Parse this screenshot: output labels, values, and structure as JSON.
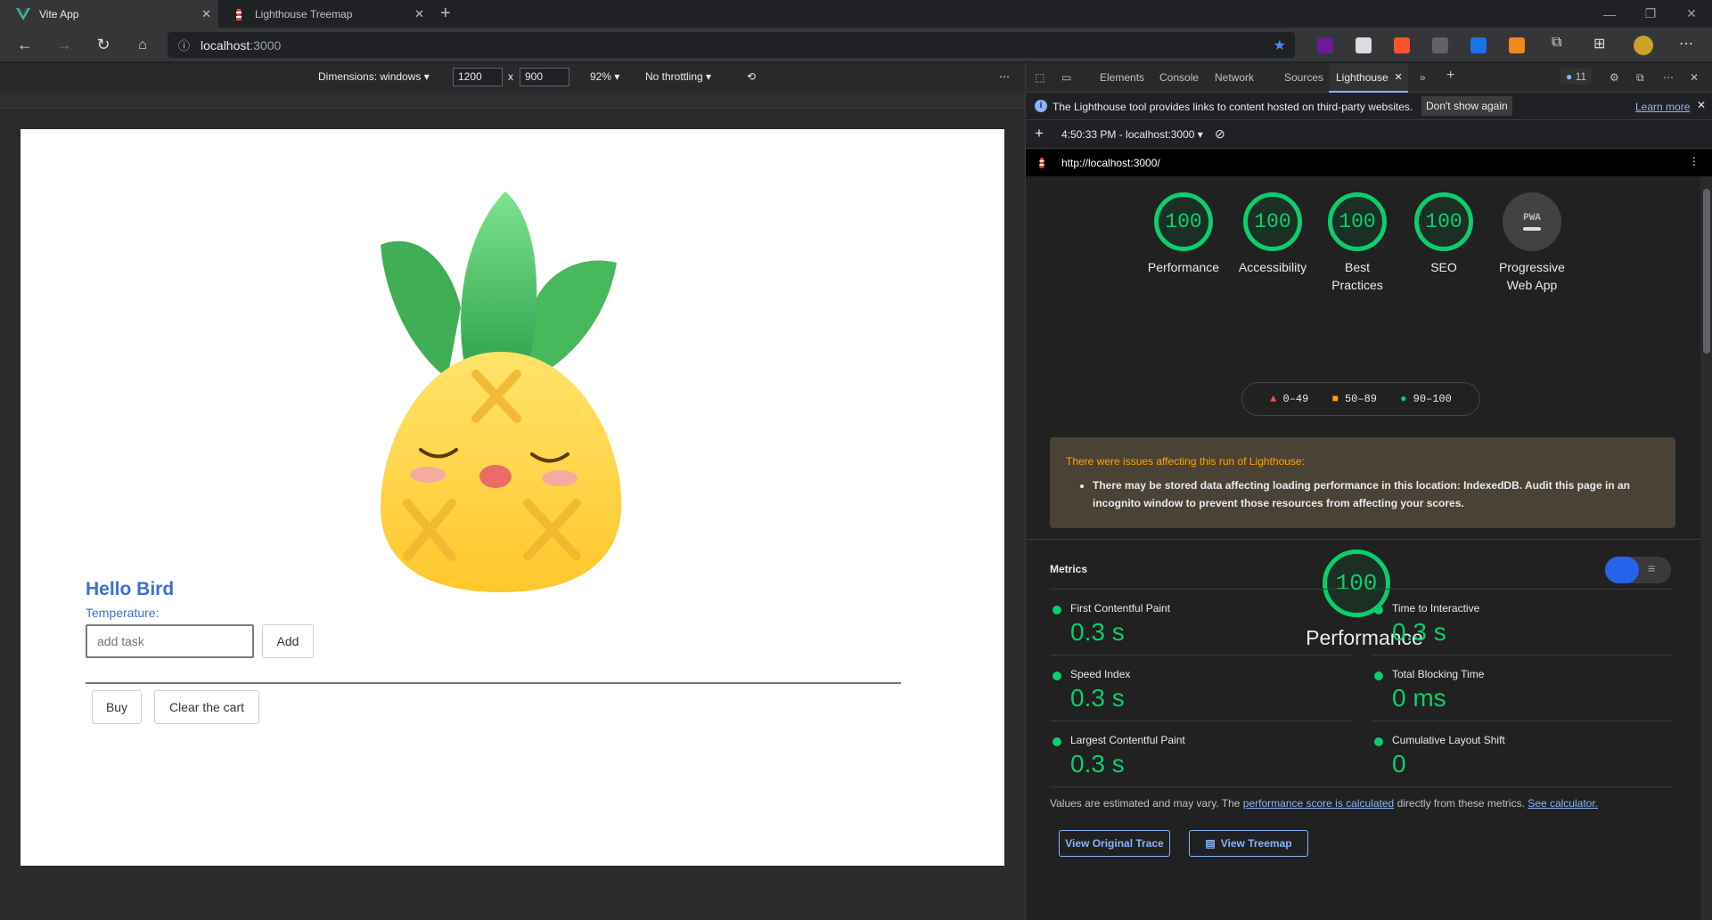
{
  "browser": {
    "tabs": [
      {
        "title": "Vite App"
      },
      {
        "title": "Lighthouse Treemap"
      }
    ],
    "address": {
      "host": "localhost",
      "port": ":3000"
    }
  },
  "device_toolbar": {
    "dimensions_label": "Dimensions: windows",
    "width": "1200",
    "height": "900",
    "times": "x",
    "zoom": "92%",
    "throttling": "No throttling"
  },
  "page": {
    "heading": "Hello Bird",
    "temperature_label": "Temperature:",
    "task_placeholder": "add task",
    "add_label": "Add",
    "buy_label": "Buy",
    "clear_label": "Clear the cart"
  },
  "devtools": {
    "tabs": [
      "Elements",
      "Console",
      "Network",
      "Sources",
      "Lighthouse"
    ],
    "issues_count": "11",
    "info_text": "The Lighthouse tool provides links to content hosted on third-party websites.",
    "dont_show": "Don't show again",
    "learn_more": "Learn more",
    "report_time": "4:50:33 PM - localhost:3000",
    "report_url": "http://localhost:3000/",
    "gauges": [
      {
        "score": "100",
        "label": "Performance"
      },
      {
        "score": "100",
        "label": "Accessibility"
      },
      {
        "score": "100",
        "label": "Best Practices"
      },
      {
        "score": "100",
        "label": "SEO"
      },
      {
        "score": "PWA",
        "label": "Progressive Web App"
      }
    ],
    "legend": [
      "0–49",
      "50–89",
      "90–100"
    ],
    "warning_title": "There were issues affecting this run of Lighthouse:",
    "warning_item": "There may be stored data affecting loading performance in this location: IndexedDB. Audit this page in an incognito window to prevent those resources from affecting your scores.",
    "perf_score": "100",
    "perf_title": "Performance",
    "metrics_heading": "Metrics",
    "metrics": [
      {
        "name": "First Contentful Paint",
        "value": "0.3 s"
      },
      {
        "name": "Time to Interactive",
        "value": "0.3 s"
      },
      {
        "name": "Speed Index",
        "value": "0.3 s"
      },
      {
        "name": "Total Blocking Time",
        "value": "0 ms"
      },
      {
        "name": "Largest Contentful Paint",
        "value": "0.3 s"
      },
      {
        "name": "Cumulative Layout Shift",
        "value": "0"
      }
    ],
    "note_prefix": "Values are estimated and may vary. The",
    "note_link": "performance score is calculated",
    "note_mid": "directly from these metrics.",
    "note_link2": "See calculator.",
    "view_trace": "View Original Trace",
    "view_treemap": "View Treemap"
  },
  "colors": {
    "pass": "#0cce6b",
    "accent": "#8ab4f8",
    "link_blue": "#3b6fd6"
  }
}
